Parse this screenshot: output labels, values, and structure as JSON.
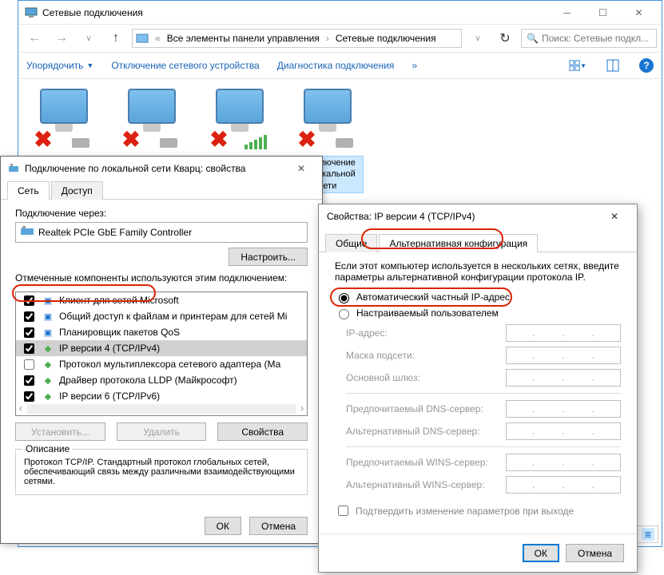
{
  "main": {
    "title": "Сетевые подключения",
    "breadcrumb": [
      "Все элементы панели управления",
      "Сетевые подключения"
    ],
    "search_placeholder": "Поиск: Сетевые подкл...",
    "toolbar": {
      "organize": "Упорядочить",
      "disable": "Отключение сетевого устройства",
      "diagnose": "Диагностика подключения"
    },
    "connections": [
      {
        "name": "",
        "disabled": true,
        "plug": true
      },
      {
        "name": "",
        "disabled": true,
        "plug": true
      },
      {
        "name": "",
        "disabled": true,
        "signal": true
      },
      {
        "name": "Подключение по локальной сети",
        "disabled": true,
        "selected": true,
        "plug": true
      }
    ]
  },
  "dlg1": {
    "title": "Подключение по локальной сети Кварц: свойства",
    "tabs": {
      "net": "Сеть",
      "access": "Доступ"
    },
    "conn_via": "Подключение через:",
    "adapter": "Realtek PCIe GbE Family Controller",
    "configure": "Настроить...",
    "components_label": "Отмеченные компоненты используются этим подключением:",
    "components": [
      {
        "checked": true,
        "label": "Клиент для сетей Microsoft",
        "ico": "net"
      },
      {
        "checked": true,
        "label": "Общий доступ к файлам и принтерам для сетей Mi",
        "ico": "net"
      },
      {
        "checked": true,
        "label": "Планировщик пакетов QoS",
        "ico": "net"
      },
      {
        "checked": true,
        "label": "IP версии 4 (TCP/IPv4)",
        "ico": "grn",
        "sel": true
      },
      {
        "checked": false,
        "label": "Протокол мультиплексора сетевого адаптера (Ма",
        "ico": "grn"
      },
      {
        "checked": true,
        "label": "Драйвер протокола LLDP (Майкрософт)",
        "ico": "grn"
      },
      {
        "checked": true,
        "label": "IP версии 6 (TCP/IPv6)",
        "ico": "grn"
      }
    ],
    "install": "Установить...",
    "remove": "Удалить",
    "properties": "Свойства",
    "desc_title": "Описание",
    "desc_text": "Протокол TCP/IP. Стандартный протокол глобальных сетей, обеспечивающий связь между различными взаимодействующими сетями.",
    "ok": "ОК",
    "cancel": "Отмена"
  },
  "dlg2": {
    "title": "Свойства: IP версии 4 (TCP/IPv4)",
    "tabs": {
      "general": "Общие",
      "alt": "Альтернативная конфигурация"
    },
    "info": "Если этот компьютер используется в нескольких сетях, введите параметры альтернативной конфигурации протокола IP.",
    "radio_auto": "Автоматический частный IP-адрес",
    "radio_user": "Настраиваемый пользователем",
    "fields": {
      "ip": "IP-адрес:",
      "mask": "Маска подсети:",
      "gw": "Основной шлюз:",
      "dns1": "Предпочитаемый DNS-сервер:",
      "dns2": "Альтернативный DNS-сервер:",
      "wins1": "Предпочитаемый WINS-сервер:",
      "wins2": "Альтернативный WINS-сервер:"
    },
    "confirm": "Подтвердить изменение параметров при выходе",
    "ok": "ОК",
    "cancel": "Отмена"
  }
}
